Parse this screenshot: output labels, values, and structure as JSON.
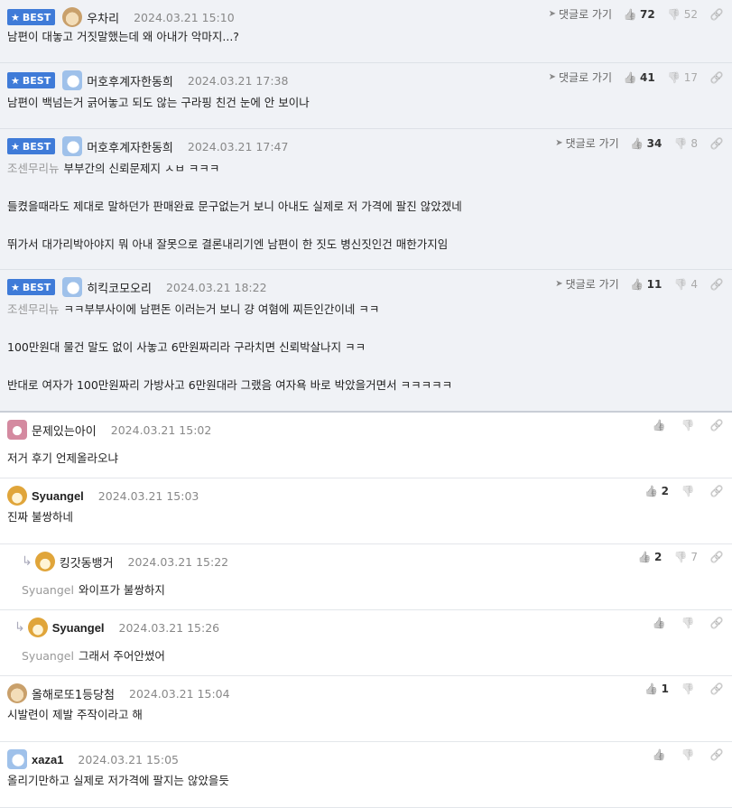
{
  "labels": {
    "best": "BEST",
    "goto": "댓글로 가기"
  },
  "comments": [
    {
      "best": true,
      "nick": "우차리",
      "avatar": "dog",
      "date": "2024.03.21 15:10",
      "up": "72",
      "down": "52",
      "lines": [
        "남편이 대놓고 거짓말했는데 왜 아내가 악마지...?"
      ]
    },
    {
      "best": true,
      "nick": "머호후계자한동희",
      "avatar": "bear",
      "date": "2024.03.21 17:38",
      "up": "41",
      "down": "17",
      "lines": [
        "남편이 백넘는거 긁어놓고 되도 않는 구라핑 친건 눈에 안 보이나"
      ]
    },
    {
      "best": true,
      "nick": "머호후계자한동희",
      "avatar": "bear",
      "date": "2024.03.21 17:47",
      "up": "34",
      "down": "8",
      "reply_to": "조센무리뉴",
      "lines": [
        "부부간의 신뢰문제지 ㅅㅂ ㅋㅋㅋ",
        "들켰을때라도 제대로 말하던가 판매완료 문구없는거 보니 아내도 실제로 저 가격에 팔진 않았겠네",
        "뛰가서 대가리박아야지 뭐 아내 잘못으로 결론내리기엔 남편이 한 짓도 병신짓인건 매한가지임"
      ]
    },
    {
      "best": true,
      "nick": "히킥코모오리",
      "avatar": "bear",
      "date": "2024.03.21 18:22",
      "up": "11",
      "down": "4",
      "reply_to": "조센무리뉴",
      "lines": [
        "ㅋㅋ부부사이에 남편돈 이러는거 보니 걍 여혐에 찌든인간이네 ㅋㅋ",
        "100만원대 물건 말도 없이 사놓고 6만원짜리라 구라치면 신뢰박살나지 ㅋㅋ",
        "반대로 여자가 100만원짜리 가방사고 6만원대라 그랬음 여자욕 바로 박았을거면서 ㅋㅋㅋㅋㅋ"
      ]
    },
    {
      "best": false,
      "nick": "문제있는아이",
      "avatar": "pink",
      "date": "2024.03.21 15:02",
      "up": "",
      "down": "",
      "lines": [
        "저거 후기 언제올라오냐"
      ]
    },
    {
      "best": false,
      "nick": "Syuangel",
      "avatar": "fox",
      "bold": true,
      "date": "2024.03.21 15:03",
      "up": "2",
      "down": "",
      "lines": [
        "진짜 불쌍하네"
      ]
    },
    {
      "best": false,
      "reply": true,
      "nick": "킹갓동뱅거",
      "avatar": "fox",
      "date": "2024.03.21 15:22",
      "up": "2",
      "down": "7",
      "reply_to": "Syuangel",
      "lines": [
        "와이프가 불쌍하지"
      ]
    },
    {
      "best": false,
      "reply": true,
      "nick": "Syuangel",
      "avatar": "fox",
      "bold": true,
      "date": "2024.03.21 15:26",
      "up": "",
      "down": "",
      "reply_to": "Syuangel",
      "lines": [
        "그래서 주어안썼어"
      ]
    },
    {
      "best": false,
      "nick": "올해로또1등당첨",
      "avatar": "dog",
      "date": "2024.03.21 15:04",
      "up": "1",
      "down": "",
      "lines": [
        "시발련이 제발 주작이라고 해"
      ]
    },
    {
      "best": false,
      "nick": "xaza1",
      "avatar": "bear",
      "bold": true,
      "date": "2024.03.21 15:05",
      "up": "",
      "down": "",
      "lines": [
        "올리기만하고 실제로 저가격에 팔지는 않았을듯"
      ]
    }
  ]
}
